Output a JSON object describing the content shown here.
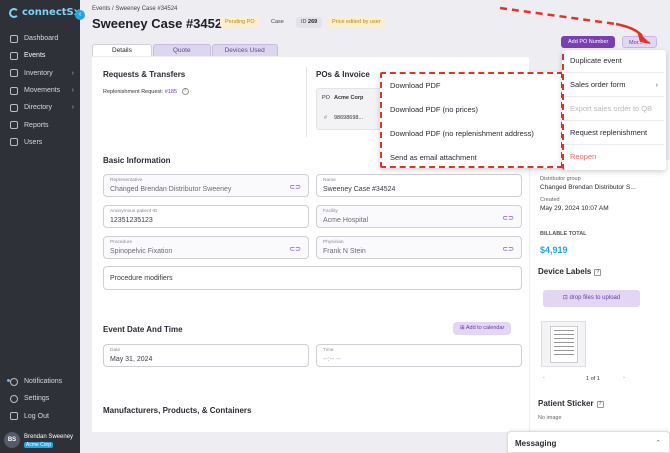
{
  "brand": {
    "name_a": "connect",
    "name_b": "Sx",
    "accent": "#26a3e0"
  },
  "sidebar": {
    "items": [
      {
        "label": "Dashboard",
        "icon": "grid-icon",
        "chevron": false
      },
      {
        "label": "Events",
        "icon": "calendar-icon",
        "chevron": false,
        "active": true
      },
      {
        "label": "Inventory",
        "icon": "box-icon",
        "chevron": true
      },
      {
        "label": "Movements",
        "icon": "truck-icon",
        "chevron": true
      },
      {
        "label": "Directory",
        "icon": "book-icon",
        "chevron": true
      },
      {
        "label": "Reports",
        "icon": "chart-icon",
        "chevron": false
      },
      {
        "label": "Users",
        "icon": "users-icon",
        "chevron": false
      }
    ],
    "bottom": [
      {
        "label": "Notifications",
        "icon": "bell-icon"
      },
      {
        "label": "Settings",
        "icon": "gear-icon"
      },
      {
        "label": "Log Out",
        "icon": "logout-icon"
      }
    ],
    "user": {
      "initials": "BS",
      "name": "Brendan Sweeney",
      "org": "Acme Corp"
    }
  },
  "header": {
    "breadcrumb": "Events / Sweeney Case #34524",
    "title": "Sweeney Case #34524",
    "badges": {
      "pending": "Pending PO",
      "type": "Case",
      "id_label": "ID",
      "id_value": "269",
      "price": "Price edited by user"
    },
    "add_po_label": "Add PO Number",
    "more_label": "Mor...",
    "more_dots": "•••"
  },
  "tabs": [
    "Details",
    "Quote",
    "Devices Used"
  ],
  "requests": {
    "title": "Requests & Transfers",
    "replenishment_label": "Replenishment Request:",
    "replenishment_link": "#185"
  },
  "pos": {
    "title": "POs & Invoice",
    "po_prefix": "PO",
    "company": "Acme Corp",
    "hash": "#",
    "number": "98698698..."
  },
  "basic": {
    "title": "Basic Information",
    "fields": [
      {
        "label": "Representative",
        "value": "Changed Brendan Distributor Sweeney"
      },
      {
        "label": "Name",
        "value": "Sweeney Case #34524"
      },
      {
        "label": "Anonymous patient ID",
        "value": "12351235123"
      },
      {
        "label": "Facility",
        "value": "Acme Hospital"
      },
      {
        "label": "Procedure",
        "value": "Spinopelvic Fixation"
      },
      {
        "label": "Physician",
        "value": "Frank N Stein"
      }
    ],
    "modifiers_placeholder": "Procedure modifiers"
  },
  "event_dt": {
    "title": "Event Date And Time",
    "add_calendar": "Add to calendar",
    "date_label": "Date",
    "date_value": "May 31, 2024",
    "time_label": "Time",
    "time_value": "--:-- --"
  },
  "manufacturers": {
    "title": "Manufacturers, Products, & Containers"
  },
  "right": {
    "partial_value": "...(...)",
    "dist_group_label": "Distributor group",
    "dist_group_value": "Changed Brendan Distributor S...",
    "created_label": "Created",
    "created_value": "May 29, 2024 10:07 AM",
    "billable_label": "BILLABLE TOTAL",
    "billable_value": "$4,919",
    "device_labels": "Device Labels",
    "drop_files": "drop files to upload",
    "pager": "1 of 1",
    "patient_sticker": "Patient Sticker",
    "patient_sticker_sub": "No image"
  },
  "messaging": {
    "title": "Messaging"
  },
  "download_menu": {
    "items": [
      "Download PDF",
      "Download PDF (no prices)",
      "Download PDF (no replenishment address)",
      "Send as email attachment"
    ]
  },
  "more_menu": {
    "items": [
      {
        "label": "Duplicate event",
        "state": "normal"
      },
      {
        "label": "Sales order form",
        "state": "submenu"
      },
      {
        "label": "Export sales order to QB",
        "state": "disabled"
      },
      {
        "label": "Request replenishment",
        "state": "normal"
      },
      {
        "label": "Reopen",
        "state": "danger"
      }
    ]
  },
  "colors": {
    "purple": "#7a3fb0",
    "annotation_red": "#e0342a",
    "blue": "#25a3e0"
  }
}
